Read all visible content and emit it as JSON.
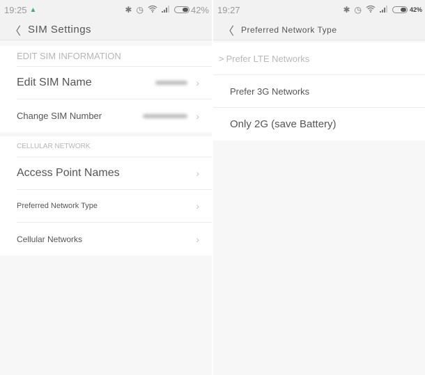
{
  "left_screen": {
    "status": {
      "time": "19:25",
      "battery_text": "42%",
      "battery_level": 0.42
    },
    "title": "SIM Settings",
    "back_glyph": "<",
    "sections": [
      {
        "header": "EDIT SIM INFORMATION",
        "items": [
          {
            "label": "Edit SIM Name",
            "value": "(blurred)",
            "chevron": ">"
          },
          {
            "label": "Change SIM Number",
            "value": "(blurred)",
            "chevron": ">"
          }
        ]
      },
      {
        "header": "CELLULAR NETWORK",
        "items": [
          {
            "label": "Access Point Names",
            "chevron": ">"
          },
          {
            "label": "Preferred Network Type",
            "chevron": ">"
          },
          {
            "label": "Cellular Networks",
            "chevron": ">"
          }
        ]
      }
    ]
  },
  "right_screen": {
    "status": {
      "time": "19:27",
      "battery_text": "42%",
      "battery_level": 0.42
    },
    "title": "Preferred Network Type",
    "back_glyph": "<",
    "options": [
      {
        "label": "Prefer LTE Networks",
        "selected": true,
        "marker": ">"
      },
      {
        "label": "Prefer 3G Networks",
        "selected": false
      },
      {
        "label": "Only 2G (save Battery)",
        "selected": false
      }
    ]
  },
  "icons": {
    "bluetooth": "✱",
    "alarm": "⏰",
    "wifi": "wifi",
    "signal": "signal"
  }
}
